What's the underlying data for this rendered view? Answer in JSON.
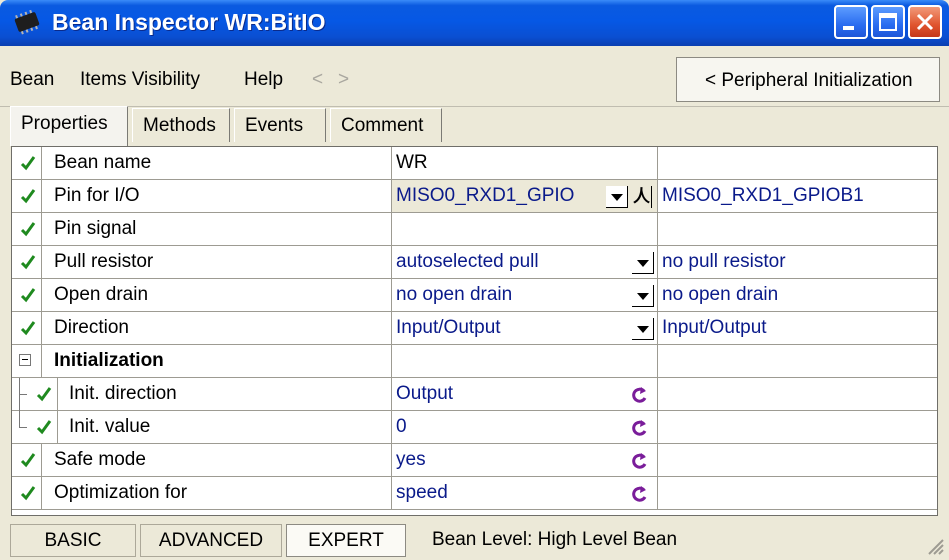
{
  "window": {
    "title": "Bean Inspector WR:BitIO"
  },
  "menu": {
    "items": [
      "Bean",
      "Items Visibility",
      "Help"
    ],
    "back_arrow": "<",
    "forward_arrow": ">"
  },
  "peripheral_button": {
    "label": "< Peripheral Initialization"
  },
  "tabs": [
    {
      "label": "Properties",
      "active": true
    },
    {
      "label": "Methods",
      "active": false
    },
    {
      "label": "Events",
      "active": false
    },
    {
      "label": "Comment",
      "active": false
    }
  ],
  "properties": [
    {
      "name": "Bean name",
      "value": "WR",
      "extra": "",
      "control": "none"
    },
    {
      "name": "Pin for I/O",
      "value": "MISO0_RXD1_GPIO",
      "extra": "MISO0_RXD1_GPIOB1",
      "control": "dropdown+pick"
    },
    {
      "name": "Pin signal",
      "value": "",
      "extra": "",
      "control": "none"
    },
    {
      "name": "Pull resistor",
      "value": "autoselected pull",
      "extra": "no pull resistor",
      "control": "dropdown"
    },
    {
      "name": "Open drain",
      "value": "no open drain",
      "extra": "no open drain",
      "control": "dropdown"
    },
    {
      "name": "Direction",
      "value": "Input/Output",
      "extra": "Input/Output",
      "control": "dropdown"
    },
    {
      "name": "Initialization",
      "value": "",
      "extra": "",
      "control": "group"
    },
    {
      "name": "Init. direction",
      "value": "Output",
      "extra": "",
      "control": "reset"
    },
    {
      "name": "Init. value",
      "value": "0",
      "extra": "",
      "control": "reset"
    },
    {
      "name": "Safe mode",
      "value": "yes",
      "extra": "",
      "control": "reset"
    },
    {
      "name": "Optimization for",
      "value": "speed",
      "extra": "",
      "control": "reset"
    }
  ],
  "status": {
    "levels": [
      "BASIC",
      "ADVANCED",
      "EXPERT"
    ],
    "active_level": "EXPERT",
    "bean_level": "Bean Level: High Level Bean"
  },
  "icons": {
    "check": "check-icon",
    "reset": "reset-default-icon",
    "dropdown": "chevron-down-icon",
    "pick": "pin-pick-icon"
  },
  "colors": {
    "title_bar": "#0658e5",
    "value_text": "#0a1a8a",
    "check": "#1f8a1f",
    "reset_icon": "#7a1d9a"
  }
}
